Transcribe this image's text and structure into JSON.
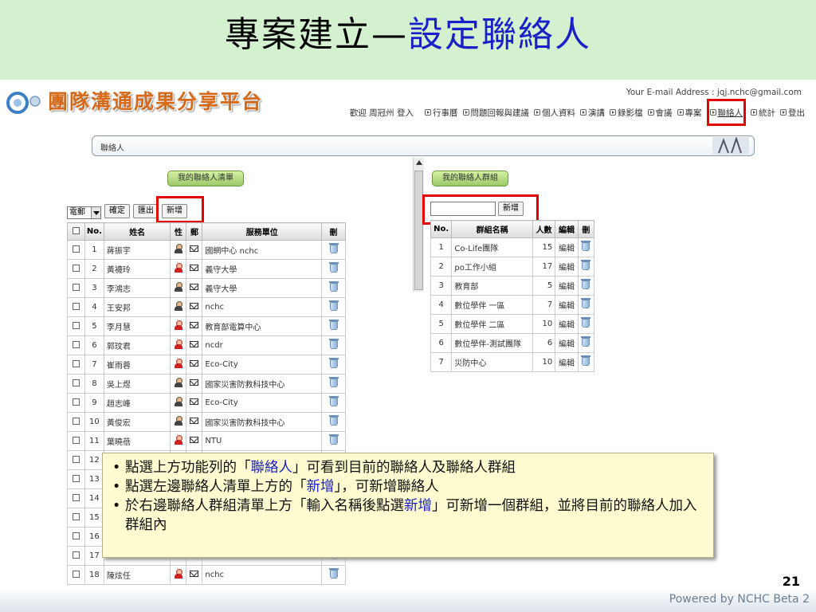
{
  "slide": {
    "title_main": "專案建立—",
    "title_highlight": "設定聯絡人",
    "page_number": "21",
    "footer": "Powered by NCHC Beta 2"
  },
  "header": {
    "logo_text": "團隊溝通成果分享平台",
    "email_line": "Your E-mail Address : jqj.nchc@gmail.com",
    "welcome": "歡迎 周冠州 登入",
    "nav": [
      {
        "label": "行事曆",
        "active": false
      },
      {
        "label": "問題回報與建議",
        "active": false
      },
      {
        "label": "個人資料",
        "active": false
      },
      {
        "label": "演講",
        "active": false
      },
      {
        "label": "錄影檔",
        "active": false
      },
      {
        "label": "會議",
        "active": false
      },
      {
        "label": "專案",
        "active": false
      },
      {
        "label": "聯絡人",
        "active": true
      },
      {
        "label": "統計",
        "active": false
      },
      {
        "label": "登出",
        "active": false
      }
    ]
  },
  "breadcrumb": "聯絡人",
  "left_panel": {
    "title_button": "我的聯絡人清單",
    "select_value": "電郵",
    "confirm_button": "確定",
    "export_button": "匯出",
    "add_button": "新增",
    "columns": [
      "",
      "No.",
      "姓名",
      "性",
      "郵",
      "服務單位",
      "刪"
    ],
    "rows": [
      {
        "no": "1",
        "name": "蔣振宇",
        "gender": "m",
        "org": "國網中心 nchc"
      },
      {
        "no": "2",
        "name": "黃襪玲",
        "gender": "f",
        "org": "義守大學"
      },
      {
        "no": "3",
        "name": "李鴻志",
        "gender": "m",
        "org": "義守大學"
      },
      {
        "no": "4",
        "name": "王安邦",
        "gender": "m",
        "org": "nchc"
      },
      {
        "no": "5",
        "name": "李月慧",
        "gender": "f",
        "org": "教育部電算中心"
      },
      {
        "no": "6",
        "name": "郭玟君",
        "gender": "f",
        "org": "ncdr"
      },
      {
        "no": "7",
        "name": "崔雨蓉",
        "gender": "f",
        "org": "Eco-City"
      },
      {
        "no": "8",
        "name": "吳上煜",
        "gender": "m",
        "org": "國家災害防救科技中心"
      },
      {
        "no": "9",
        "name": "趙志峰",
        "gender": "m",
        "org": "Eco-City"
      },
      {
        "no": "10",
        "name": "黃俊宏",
        "gender": "m",
        "org": "國家災害防救科技中心"
      },
      {
        "no": "11",
        "name": "葉曉蓓",
        "gender": "f",
        "org": "NTU"
      },
      {
        "no": "12",
        "name": "",
        "gender": "",
        "org": ""
      },
      {
        "no": "13",
        "name": "",
        "gender": "",
        "org": ""
      },
      {
        "no": "14",
        "name": "",
        "gender": "",
        "org": ""
      },
      {
        "no": "15",
        "name": "",
        "gender": "",
        "org": ""
      },
      {
        "no": "16",
        "name": "",
        "gender": "",
        "org": ""
      },
      {
        "no": "17",
        "name": "",
        "gender": "",
        "org": ""
      },
      {
        "no": "18",
        "name": "陳炫任",
        "gender": "f",
        "org": "nchc"
      }
    ]
  },
  "right_panel": {
    "title_button": "我的聯絡人群組",
    "add_button": "新增",
    "input_value": "",
    "columns": [
      "No.",
      "群組名稱",
      "人數",
      "編輯",
      "刪"
    ],
    "edit_label": "編輯",
    "rows": [
      {
        "no": "1",
        "name": "Co-Life團隊",
        "count": "15"
      },
      {
        "no": "2",
        "name": "po工作小組",
        "count": "17"
      },
      {
        "no": "3",
        "name": "教育部",
        "count": "5"
      },
      {
        "no": "4",
        "name": "數位學伴 一區",
        "count": "7"
      },
      {
        "no": "5",
        "name": "數位學伴 二區",
        "count": "10"
      },
      {
        "no": "6",
        "name": "數位學伴-測試團隊",
        "count": "6"
      },
      {
        "no": "7",
        "name": "災防中心",
        "count": "10"
      }
    ]
  },
  "callout": {
    "line1_a": "點選上方功能列的「",
    "line1_hl": "聯絡人",
    "line1_b": "」可看到目前的聯絡人及聯絡人群組",
    "line2_a": "點選左邊聯絡人清單上方的「",
    "line2_hl": "新增",
    "line2_b": "」，可新增聯絡人",
    "line3_a": "於右邊聯絡人群組清單上方「輸入名稱後點選",
    "line3_hl": "新增",
    "line3_b": "」可新增一個群組，並將目前的聯絡人加入群組內"
  },
  "colors": {
    "title_band": "#d3f0cf",
    "highlight": "#1a20c8",
    "annotation_red": "#e20000",
    "callout_bg": "#fefbd0"
  }
}
